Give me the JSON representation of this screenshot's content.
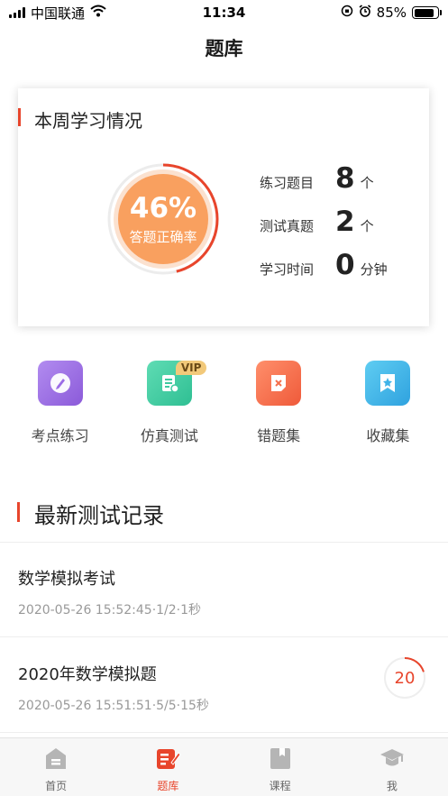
{
  "status_bar": {
    "carrier": "中国联通",
    "time": "11:34",
    "battery": "85%",
    "battery_level": 0.85
  },
  "page": {
    "title": "题库"
  },
  "weekly": {
    "title": "本周学习情况",
    "accuracy_value": "46%",
    "accuracy_fraction": 0.46,
    "accuracy_label": "答题正确率",
    "stats": [
      {
        "label": "练习题目",
        "value": "8",
        "unit": "个"
      },
      {
        "label": "测试真题",
        "value": "2",
        "unit": "个"
      },
      {
        "label": "学习时间",
        "value": "0",
        "unit": "分钟"
      }
    ]
  },
  "actions": [
    {
      "label": "考点练习",
      "icon": "pencil-icon",
      "color": "#9b6be6"
    },
    {
      "label": "仿真测试",
      "icon": "exam-paper-icon",
      "color": "#3ec9a0",
      "badge": "VIP"
    },
    {
      "label": "错题集",
      "icon": "wrong-answer-icon",
      "color": "#f56f4c"
    },
    {
      "label": "收藏集",
      "icon": "star-bookmark-icon",
      "color": "#3fb3e8"
    }
  ],
  "records_section": {
    "title": "最新测试记录"
  },
  "records": [
    {
      "name": "数学模拟考试",
      "meta": "2020-05-26 15:52:45·1/2·1秒"
    },
    {
      "name": "2020年数学模拟题",
      "meta": "2020-05-26 15:51:51·5/5·15秒",
      "score": "20"
    }
  ],
  "tabs": [
    {
      "label": "首页",
      "icon": "home-icon",
      "active": false
    },
    {
      "label": "题库",
      "icon": "question-bank-icon",
      "active": true
    },
    {
      "label": "课程",
      "icon": "course-icon",
      "active": false
    },
    {
      "label": "我",
      "icon": "profile-cap-icon",
      "active": false
    }
  ],
  "colors": {
    "accent": "#e8452c",
    "ring_fill": "#f9a05f"
  }
}
